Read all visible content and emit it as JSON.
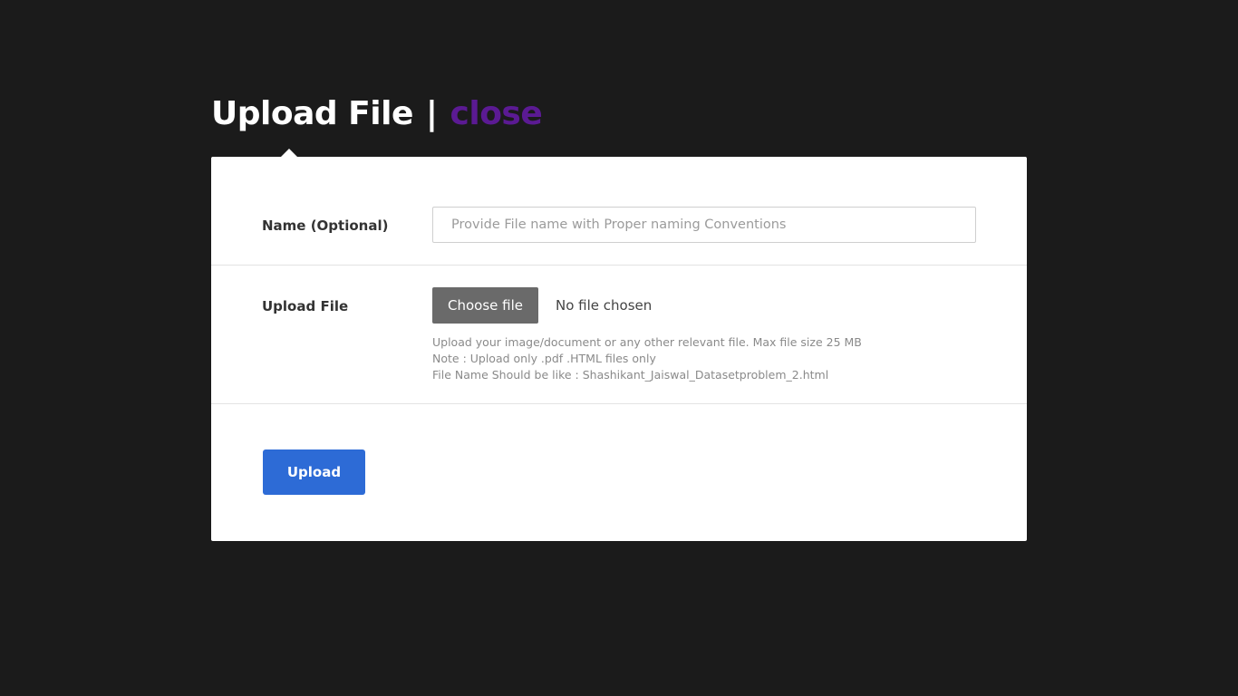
{
  "header": {
    "title": "Upload File",
    "separator": "|",
    "close_label": "close"
  },
  "form": {
    "name_field": {
      "label": "Name (Optional)",
      "value": "",
      "placeholder": "Provide File name with Proper naming Conventions"
    },
    "file_field": {
      "label": "Upload File",
      "choose_button_label": "Choose file",
      "status_text": "No file chosen",
      "help_lines": [
        "Upload your image/document or any other relevant file. Max file size 25 MB",
        "Note : Upload only .pdf .HTML files only",
        "File Name Should be like : Shashikant_Jaiswal_Datasetproblem_2.html"
      ]
    },
    "submit_label": "Upload"
  },
  "colors": {
    "background": "#1b1b1b",
    "card": "#ffffff",
    "close_link": "#5b1a93",
    "choose_button": "#6a6a6a",
    "upload_button": "#2d6bd6"
  }
}
